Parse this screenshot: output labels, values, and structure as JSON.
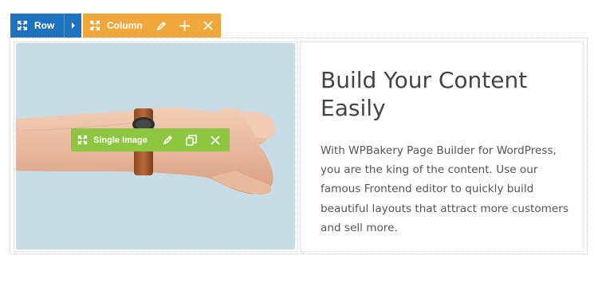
{
  "row_toolbar": {
    "label": "Row",
    "move_icon": "move-arrows-icon",
    "expand_icon": "caret-right-icon"
  },
  "column_toolbar": {
    "label": "Column",
    "icons": [
      "move-arrows-icon",
      "pencil-icon",
      "plus-icon",
      "close-icon"
    ]
  },
  "single_image_toolbar": {
    "label": "Single Image",
    "icons": [
      "move-arrows-icon",
      "pencil-icon",
      "duplicate-icon",
      "close-icon"
    ]
  },
  "content": {
    "heading": "Build Your Content Easily",
    "body": "With WPBakery Page Builder for WordPress, you are the king of the content. Use our famous Frontend editor to quickly build beautiful layouts that attract more customers and sell more."
  },
  "colors": {
    "row": "#1e73be",
    "column": "#f0a83c",
    "element": "#8dc63f"
  }
}
